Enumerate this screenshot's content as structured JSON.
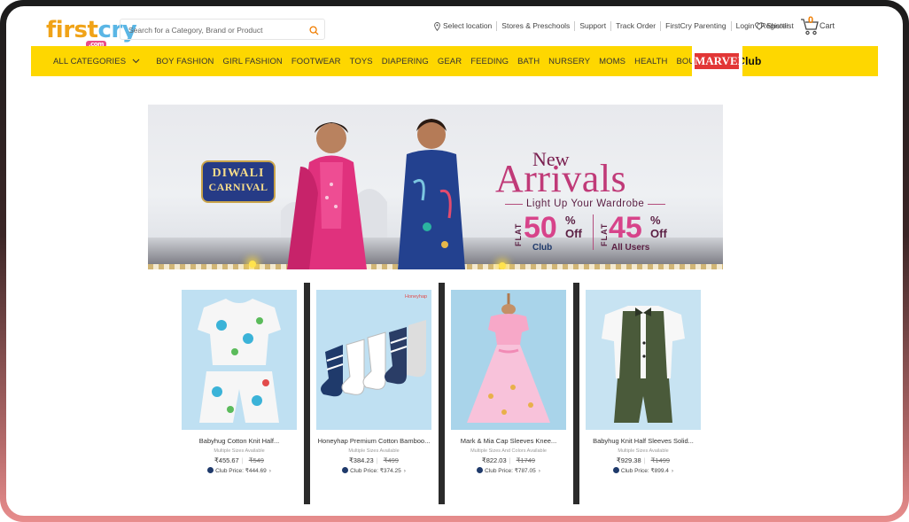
{
  "header": {
    "logo_text_1": "first",
    "logo_text_2": "cry",
    "logo_tag": ".com",
    "search_placeholder": "Search for a Category, Brand or Product",
    "links": [
      "Select location",
      "Stores & Preschools",
      "Support",
      "Track Order",
      "FirstCry Parenting",
      "Login / Register"
    ],
    "shortlist": "Shortlist",
    "cart_label": "Cart",
    "cart_count": "0"
  },
  "nav": {
    "all_categories": "ALL CATEGORIES",
    "items": [
      "BOY FASHION",
      "GIRL FASHION",
      "FOOTWEAR",
      "TOYS",
      "DIAPERING",
      "GEAR",
      "FEEDING",
      "BATH",
      "NURSERY",
      "MOMS",
      "HEALTH",
      "BOUTIQUES"
    ],
    "club": "Club",
    "marvel": "MARVEL"
  },
  "banner": {
    "badge_line1": "DIWALI",
    "badge_line2": "CARNIVAL",
    "new": "New",
    "arrivals": "Arrivals",
    "subtitle": "Light Up Your Wardrobe",
    "offer1_flat": "FLAT",
    "offer1_value": "50",
    "offer1_pct": "%",
    "offer1_off": "Off",
    "offer1_label": "Club",
    "offer2_flat": "FLAT",
    "offer2_value": "45",
    "offer2_pct": "%",
    "offer2_off": "Off",
    "offer2_label": "All Users"
  },
  "products": [
    {
      "name": "Babyhug Cotton Knit Half...",
      "availability": "Multiple Sizes Available",
      "price": "₹455.67",
      "mrp": "₹549",
      "club_price": "Club Price: ₹444.69"
    },
    {
      "name": "Honeyhap Premium Cotton Bamboo...",
      "availability": "Multiple Sizes Available",
      "price": "₹384.23",
      "mrp": "₹499",
      "club_price": "Club Price: ₹374.25",
      "brand_tag": "Honeyhap"
    },
    {
      "name": "Mark & Mia Cap Sleeves Knee...",
      "availability": "Multiple Sizes And Colors Available",
      "price": "₹822.03",
      "mrp": "₹1749",
      "club_price": "Club Price: ₹787.05"
    },
    {
      "name": "Babyhug Knit Half Sleeves Solid...",
      "availability": "Multiple Sizes Available",
      "price": "₹929.38",
      "mrp": "₹1499",
      "club_price": "Club Price: ₹899.4"
    }
  ],
  "colors": {
    "nav_bg": "#fed700",
    "accent": "#f07d00",
    "pink": "#c03a78"
  }
}
